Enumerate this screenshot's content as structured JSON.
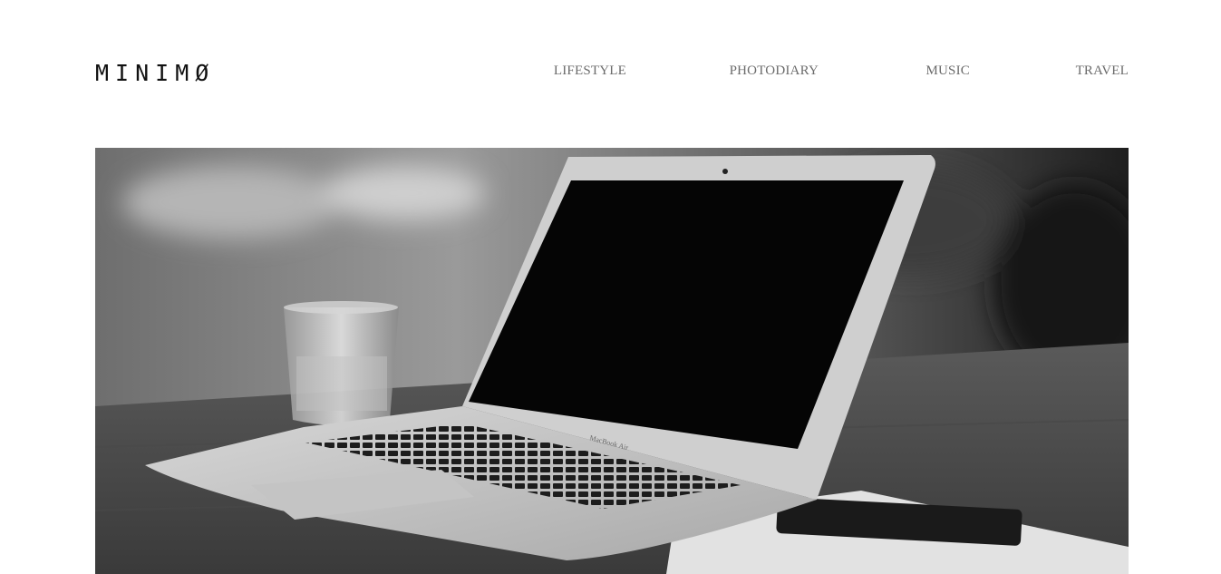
{
  "header": {
    "logo": "MINIMØ",
    "nav": [
      {
        "label": "LIFESTYLE"
      },
      {
        "label": "PHOTODIARY"
      },
      {
        "label": "MUSIC"
      },
      {
        "label": "TRAVEL"
      }
    ]
  },
  "hero": {
    "laptop_label": "MacBook Air"
  },
  "colors": {
    "text": "#111111",
    "nav": "#6b6b6b",
    "background": "#ffffff"
  }
}
